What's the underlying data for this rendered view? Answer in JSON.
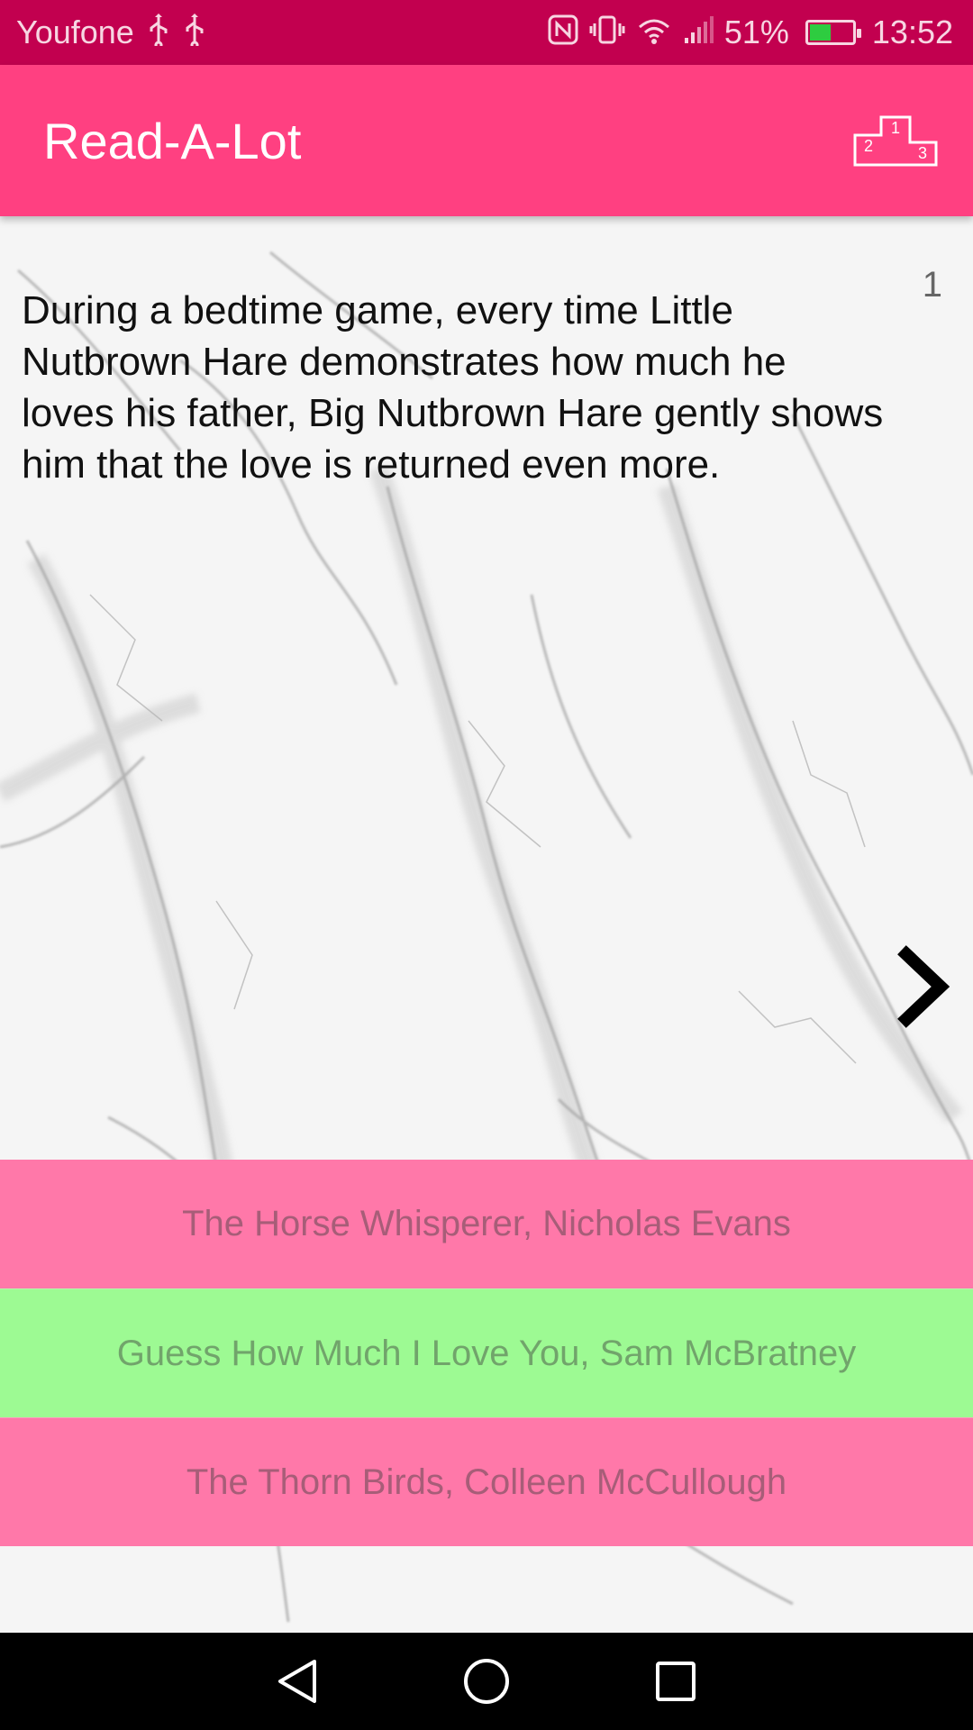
{
  "status_bar": {
    "carrier": "Youfone",
    "battery_percent": "51%",
    "battery_level": 0.51,
    "time": "13:52",
    "icons": [
      "usb-icon",
      "usb-icon",
      "nfc-icon",
      "vibrate-icon",
      "wifi-icon",
      "signal-icon",
      "battery-icon"
    ]
  },
  "app_bar": {
    "title": "Read-A-Lot",
    "podium_icon": "podium-icon",
    "podium_labels": [
      "2",
      "1",
      "3"
    ]
  },
  "question": {
    "number": "1",
    "description": "During a bedtime game, every time Little Nutbrown Hare demonstrates how much he loves his father, Big Nutbrown Hare gently shows him that the love is returned even more."
  },
  "options": [
    {
      "label": "The Horse Whisperer, Nicholas Evans",
      "state": "pink"
    },
    {
      "label": "Guess How Much I Love You, Sam McBratney",
      "state": "green"
    },
    {
      "label": "The Thorn Birds, Colleen McCullough",
      "state": "pink"
    }
  ],
  "colors": {
    "status_bar": "#c2004f",
    "app_bar": "#ff4081",
    "option_pink": "#ff78a9",
    "option_green": "#9dfa93"
  },
  "nav_bar": [
    "back-icon",
    "home-icon",
    "recents-icon"
  ]
}
